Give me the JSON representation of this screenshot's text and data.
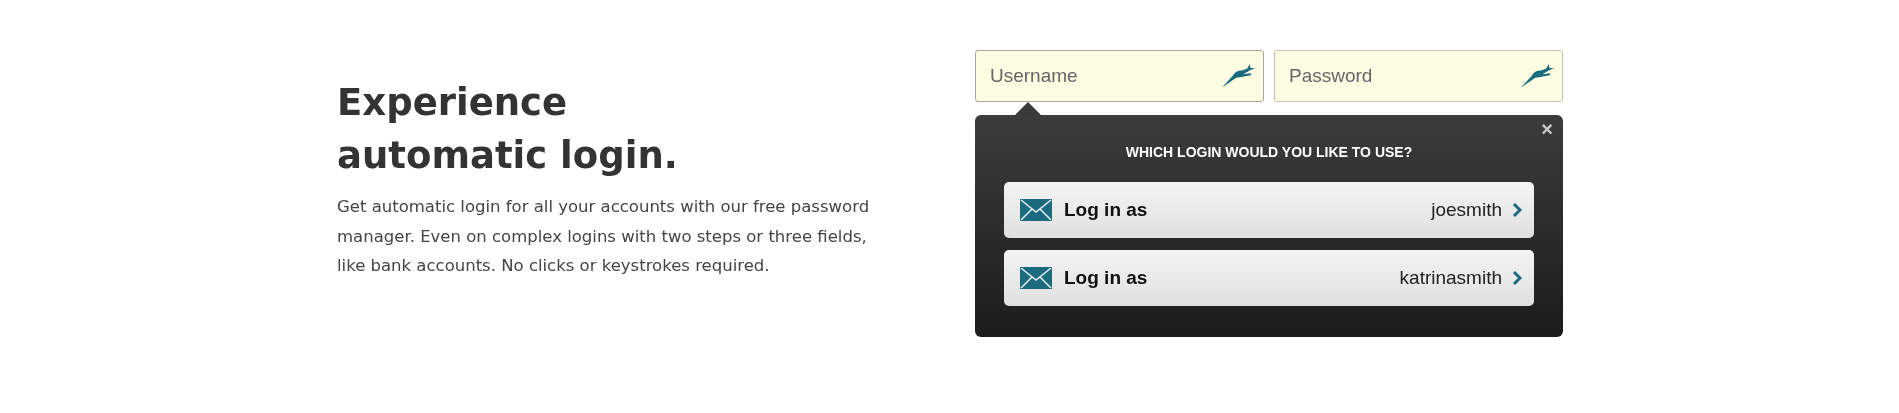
{
  "headline": "Experience automatic login.",
  "description": "Get automatic login for all your accounts with our free password manager. Even on complex logins with two steps or three fields, like bank accounts. No clicks or keystrokes required.",
  "fields": [
    {
      "placeholder": "Username",
      "selected": true
    },
    {
      "placeholder": "Password",
      "selected": false
    }
  ],
  "popup": {
    "close": "×",
    "title": "WHICH LOGIN WOULD YOU LIKE TO USE?",
    "accounts": [
      {
        "action": "Log in as",
        "username": "joesmith"
      },
      {
        "action": "Log in as",
        "username": "katrinasmith"
      }
    ]
  }
}
